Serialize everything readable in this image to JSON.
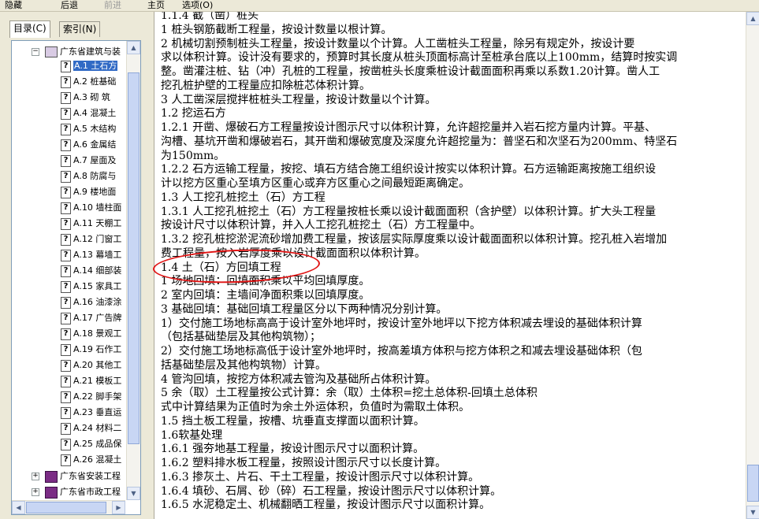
{
  "toolbar": {
    "items": [
      "隐藏",
      "后退",
      "前进",
      "主页",
      "选项(O)"
    ]
  },
  "tabs": [
    "目录(C)",
    "索引(N)"
  ],
  "tree": {
    "root_label": "广东省建筑与装",
    "items": [
      {
        "code": "A.1",
        "label": "土石方"
      },
      {
        "code": "A.2",
        "label": "桩基础"
      },
      {
        "code": "A.3",
        "label": "砌  筑"
      },
      {
        "code": "A.4",
        "label": "混凝土"
      },
      {
        "code": "A.5",
        "label": "木结构"
      },
      {
        "code": "A.6",
        "label": "金属结"
      },
      {
        "code": "A.7",
        "label": "屋面及"
      },
      {
        "code": "A.8",
        "label": "防腐与"
      },
      {
        "code": "A.9",
        "label": "楼地面"
      },
      {
        "code": "A.10",
        "label": "墙柱面"
      },
      {
        "code": "A.11",
        "label": "天棚工"
      },
      {
        "code": "A.12",
        "label": "门窗工"
      },
      {
        "code": "A.13",
        "label": "幕墙工"
      },
      {
        "code": "A.14",
        "label": "细部装"
      },
      {
        "code": "A.15",
        "label": "家具工"
      },
      {
        "code": "A.16",
        "label": "油漆涂"
      },
      {
        "code": "A.17",
        "label": "广告牌"
      },
      {
        "code": "A.18",
        "label": "景观工"
      },
      {
        "code": "A.19",
        "label": "石作工"
      },
      {
        "code": "A.20",
        "label": "其他工"
      },
      {
        "code": "A.21",
        "label": "模板工"
      },
      {
        "code": "A.22",
        "label": "脚手架"
      },
      {
        "code": "A.23",
        "label": "垂直运"
      },
      {
        "code": "A.24",
        "label": "材料二"
      },
      {
        "code": "A.25",
        "label": "成品保"
      },
      {
        "code": "A.26",
        "label": "混凝土"
      }
    ],
    "other_books": [
      "广东省安装工程",
      "广东省市政工程"
    ]
  },
  "content_lines": [
    "1.1.4  截（凿）桩头",
    "    1  桩头钢筋截断工程量，按设计数量以根计算。",
    "    2  机械切割预制桩头工程量，按设计数量以个计算。人工凿桩头工程量，除另有规定外，按设计要",
    "求以体积计算。设计没有要求的，预算时其长度从桩头顶面标高计至桩承台底以上100mm，结算时按实调",
    "整。凿灌注桩、钻（冲）孔桩的工程量，按凿桩头长度乘桩设计截面面积再乘以系数1.20计算。凿人工",
    "挖孔桩护壁的工程量应扣除桩芯体积计算。",
    "    3  人工凿深层搅拌桩桩头工程量，按设计数量以个计算。",
    "1.2  挖运石方",
    "1.2.1  开凿、爆破石方工程量按设计图示尺寸以体积计算，允许超挖量并入岩石挖方量内计算。平基、",
    "沟槽、基坑开凿和爆破岩石，其开凿和爆破宽度及深度允许超挖量为：普坚石和次坚石为200mm、特坚石",
    "为150mm。",
    "1.2.2  石方运输工程量，按挖、填石方结合施工组织设计按实以体积计算。石方运输距离按施工组织设",
    "计以挖方区重心至填方区重心或弃方区重心之间最短距离确定。",
    "1.3  人工挖孔桩挖土（石）方工程",
    "1.3.1  人工挖孔桩挖土（石）方工程量按桩长乘以设计截面面积（含护壁）以体积计算。扩大头工程量",
    "按设计尺寸以体积计算，并入人工挖孔桩挖土（石）方工程量中。",
    "1.3.2  挖孔桩挖淤泥流砂增加费工程量，按该层实际厚度乘以设计截面面积以体积计算。挖孔桩入岩增加",
    "费工程量，按入岩厚度乘以设计截面面积以体积计算。",
    "1.4  土（石）方回填工程",
    "    1  场地回填：回填面积乘以平均回填厚度。",
    "    2  室内回填：主墙间净面积乘以回填厚度。",
    "    3  基础回填：基础回填工程量区分以下两种情况分别计算。",
    "      1）交付施工场地标高高于设计室外地坪时，按设计室外地坪以下挖方体积减去埋设的基础体积计算",
    "（包括基础垫层及其他构筑物）；",
    "      2）交付施工场地标高低于设计室外地坪时，按高差填方体积与挖方体积之和减去埋设基础体积（包",
    "括基础垫层及其他构筑物）计算。",
    "    4  管沟回填，按挖方体积减去管沟及基础所占体积计算。",
    "    5  余（取）土工程量按公式计算：余（取）土体积=挖土总体积-回填土总体积",
    "    式中计算结果为正值时为余土外运体积，负值时为需取土体积。",
    "1.5  挡土板工程量，按槽、坑垂直支撑面以面积计算。",
    "1.6软基处理",
    "1.6.1  强夯地基工程量，按设计图示尺寸以面积计算。",
    "1.6.2  塑料排水板工程量，按照设计图示尺寸以长度计算。",
    "1.6.3  掺灰土、片石、干土工程量，按设计图示尺寸以体积计算。",
    "1.6.4  填砂、石屑、砂（碎）石工程量，按设计图示尺寸以体积计算。",
    "1.6.5  水泥稳定土、机械翻晒工程量，按设计图示尺寸以面积计算。"
  ],
  "icons": {
    "help_topic": "question-page-icon",
    "book_closed": "book-closed-icon",
    "book_open": "book-open-icon"
  },
  "colors": {
    "selection": "#316ac5",
    "annotation_circle": "#e01515",
    "window_bg": "#ece9d8"
  }
}
